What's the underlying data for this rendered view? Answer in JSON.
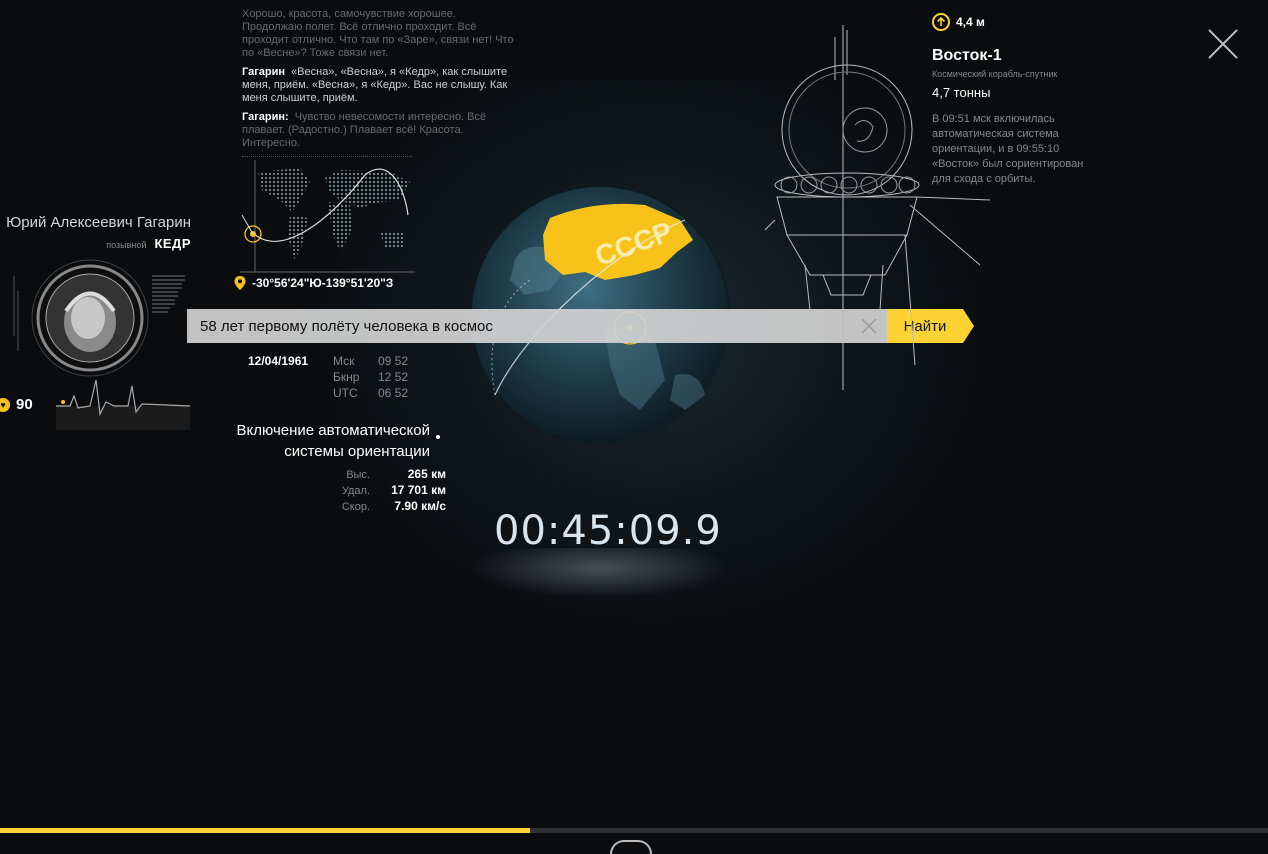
{
  "transcript": {
    "lines": [
      {
        "speaker": "",
        "text": "Хорошо, красота, самочувствие хорошее. Продолжаю полет. Всё отлично проходит. Всё проходит отлично. Что там по «Заре», связи нет! Что по «Весне»? Тоже связи нет.",
        "style": "faded"
      },
      {
        "speaker": "Гагарин",
        "text": "«Весна», «Весна», я «Кедр», как слышите меня, приём. «Весна», я «Кедр». Вас не слышу. Как меня слышите, приём.",
        "style": "bright"
      },
      {
        "speaker": "Гагарин:",
        "text": "Чувство невесомости интересно. Всё плавает. (Радостно.) Плавает всё! Красота. Интересно.",
        "style": "faded"
      }
    ]
  },
  "location": {
    "coords": "-30°56'24\"Ю-139°51'20\"З",
    "icon": "map-pin-icon"
  },
  "person": {
    "name": "Юрий Алексеевич Гагарин",
    "callsign_label": "позывной",
    "callsign": "КЕДР",
    "heart_rate": "90",
    "heart_icon": "heart-icon"
  },
  "search": {
    "value": "58 лет первому полёту человека в космос",
    "button": "Найти"
  },
  "datetime": {
    "date": "12/04/1961",
    "zones": [
      {
        "label": "Мск",
        "time": "09 52"
      },
      {
        "label": "Бкнр",
        "time": "12 52"
      },
      {
        "label": "UTC",
        "time": "06 52"
      }
    ]
  },
  "event": {
    "title_line1": "Включение автоматической",
    "title_line2": "системы ориентации",
    "stats": [
      {
        "label": "Выс.",
        "value": "265 км"
      },
      {
        "label": "Удал.",
        "value": "17 701 км"
      },
      {
        "label": "Скор.",
        "value": "7.90 км/с"
      }
    ]
  },
  "timer": "00:45:09.9",
  "globe": {
    "label": "СССР"
  },
  "craft": {
    "height": "4,4 м",
    "name": "Восток-1",
    "subtitle": "Космический корабль-спутник",
    "mass": "4,7 тонны",
    "description": "В 09:51 мск включилась автоматическая система ориентации, и в 09:55:10 «Восток» был сориентирован для схода с орбиты."
  },
  "progress": {
    "fraction": 0.418
  },
  "colors": {
    "accent": "#fdd333",
    "background": "#0a0c0e"
  }
}
